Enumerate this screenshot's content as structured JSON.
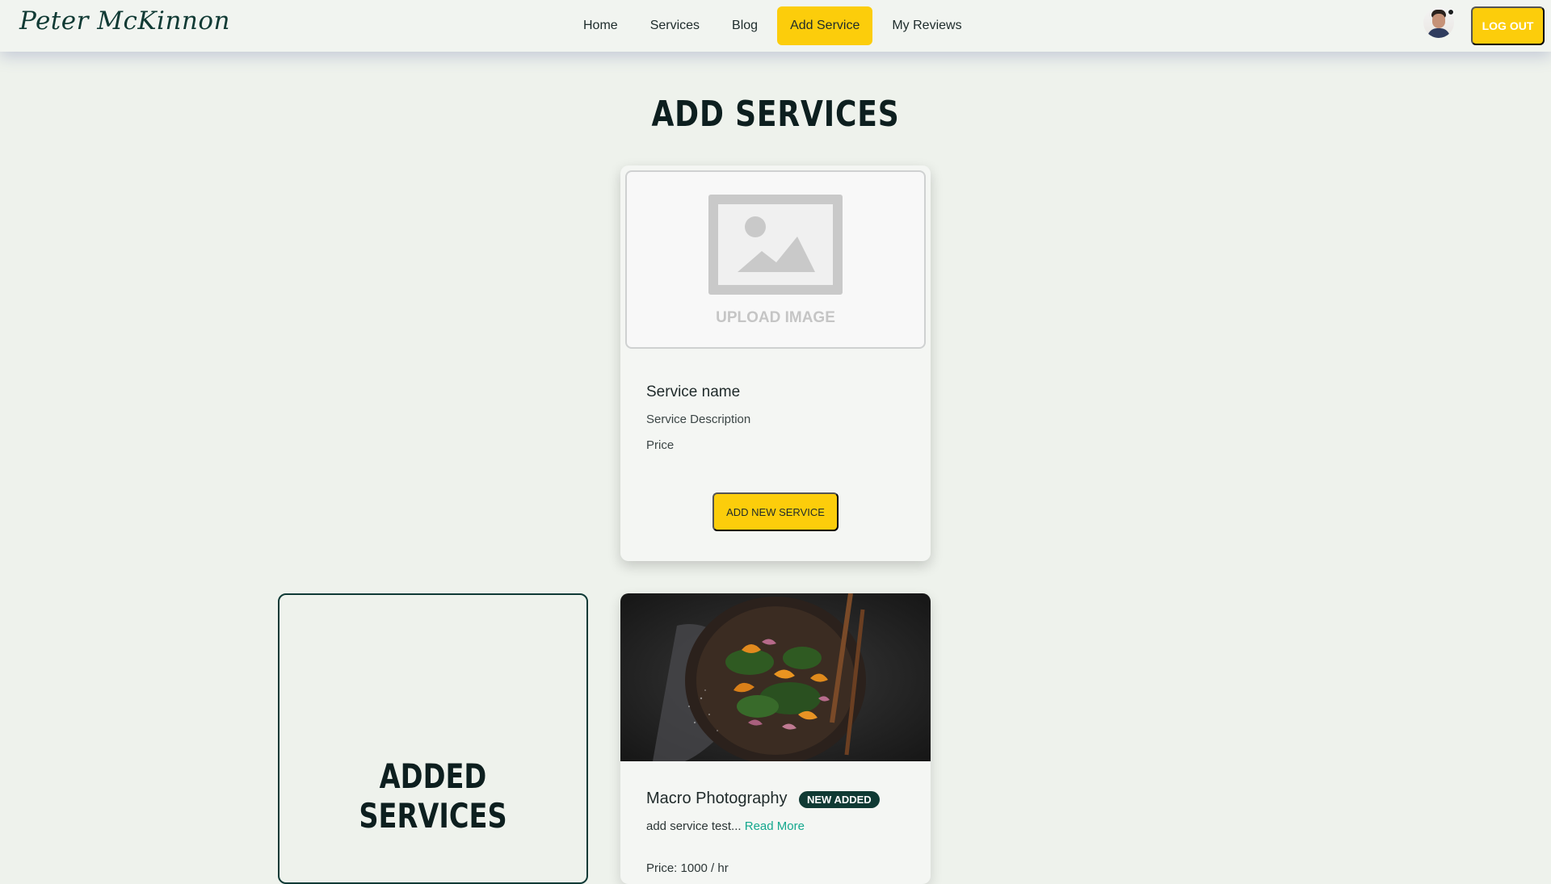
{
  "brand": {
    "name": "Peter McKinnon"
  },
  "nav": {
    "links": [
      {
        "label": "Home",
        "active": false
      },
      {
        "label": "Services",
        "active": false
      },
      {
        "label": "Blog",
        "active": false
      },
      {
        "label": "Add Service",
        "active": true
      },
      {
        "label": "My Reviews",
        "active": false
      }
    ],
    "logout_label": "LOG OUT"
  },
  "page": {
    "title": "ADD SERVICES"
  },
  "add_form": {
    "upload_label": "UPLOAD IMAGE",
    "name_label": "Service name",
    "description_label": "Service Description",
    "price_label": "Price",
    "submit_label": "ADD NEW SERVICE"
  },
  "added_section": {
    "title": "ADDED SERVICES"
  },
  "services": [
    {
      "title": "Macro Photography",
      "badge": "NEW ADDED",
      "description": "add service test...",
      "read_more": "Read More",
      "price": "Price: 1000 / hr"
    }
  ],
  "colors": {
    "accent": "#fccd0b",
    "brand_dark": "#103a34",
    "background": "#eef2ec",
    "link": "#14a88e"
  }
}
